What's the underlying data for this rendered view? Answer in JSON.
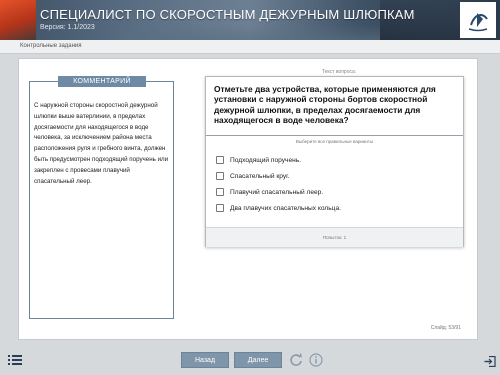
{
  "header": {
    "title": "СПЕЦИАЛИСТ ПО СКОРОСТНЫМ ДЕЖУРНЫМ ШЛЮПКАМ",
    "version": "Версия: 1.1/2023"
  },
  "breadcrumb": "Контрольные задания",
  "comment": {
    "title": "КОММЕНТАРИЙ",
    "text": "С наружной стороны скоростной дежурной шлюпки выше ватерлинии, в пределах досягаемости для находящегося в воде человека, за исключением района места расположения руля и гребного винта, должен быть предусмотрен подходящий поручень или закреплен с провесами плавучий спасательный леер."
  },
  "question": {
    "caption": "Текст вопроса:",
    "text": "Отметьте два устройства, которые применяются для установки с наружной стороны бортов скоростной дежурной шлюпки, в пределах досягаемости для находящегося в воде человека?",
    "instruction": "Выберите все правильные варианты",
    "options": [
      {
        "label": "Подходящий поручень."
      },
      {
        "label": "Спасательный круг."
      },
      {
        "label": "Плавучий спасательный леер."
      },
      {
        "label": "Два плавучих спасательных кольца."
      }
    ],
    "attempts": "Попыток: 1"
  },
  "slide_counter": "Слайд: 53/91",
  "nav": {
    "back_label": "Назад",
    "next_label": "Далее"
  },
  "icons": {
    "menu": "menu-icon",
    "refresh": "refresh-icon",
    "info": "info-icon",
    "exit": "exit-icon",
    "logo": "logo-icon"
  },
  "colors": {
    "accent": "#7f95aa",
    "comment_header": "#6f8aa4"
  }
}
